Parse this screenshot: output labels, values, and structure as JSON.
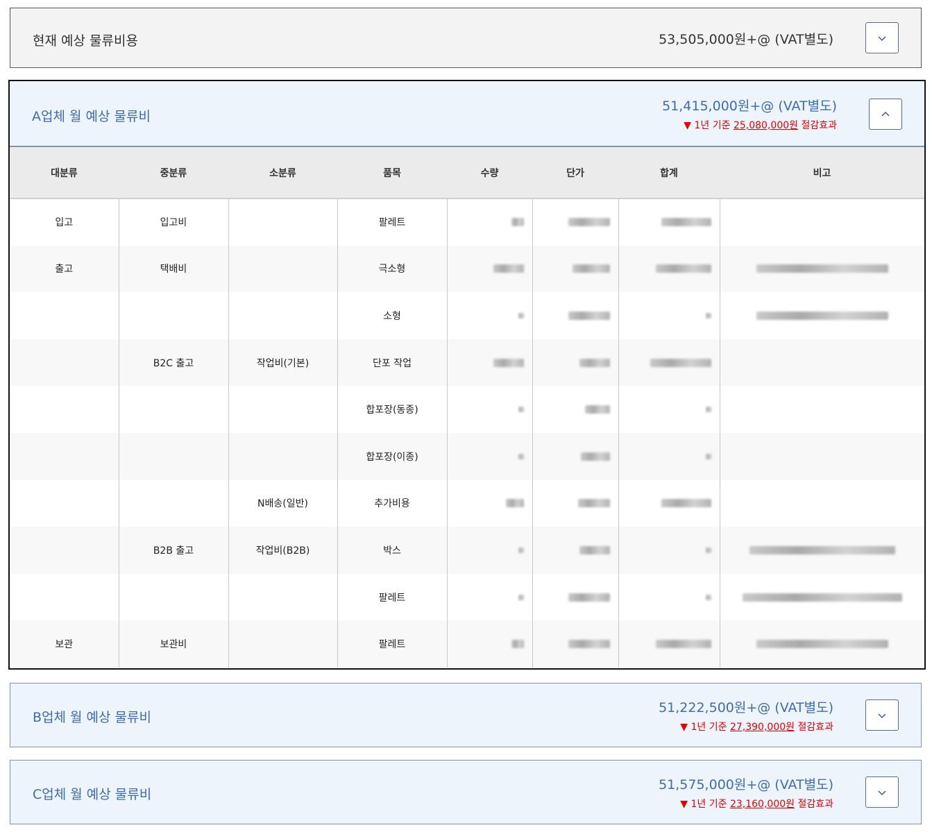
{
  "total": {
    "title": "현재 예상 물류비용",
    "amount": "53,505,000원+@ (VAT별도)",
    "toggle_icon": "chevron-down-icon"
  },
  "vendors": [
    {
      "title": "A업체 월 예상 물류비",
      "amount": "51,415,000원+@ (VAT별도)",
      "saving_prefix": "1년 기준 ",
      "saving_amount": "25,080,000원",
      "saving_suffix": " 절감효과",
      "expanded": true,
      "toggle_icon": "chevron-up-icon"
    },
    {
      "title": "B업체 월 예상 물류비",
      "amount": "51,222,500원+@ (VAT별도)",
      "saving_prefix": "1년 기준 ",
      "saving_amount": "27,390,000원",
      "saving_suffix": " 절감효과",
      "expanded": false,
      "toggle_icon": "chevron-down-icon"
    },
    {
      "title": "C업체 월 예상 물류비",
      "amount": "51,575,000원+@ (VAT별도)",
      "saving_prefix": "1년 기준 ",
      "saving_amount": "23,160,000원",
      "saving_suffix": " 절감효과",
      "expanded": false,
      "toggle_icon": "chevron-down-icon"
    }
  ],
  "table": {
    "headers": [
      "대분류",
      "중분류",
      "소분류",
      "품목",
      "수량",
      "단가",
      "합계",
      "비고"
    ],
    "rows": [
      [
        "입고",
        "입고비",
        "",
        "팔레트"
      ],
      [
        "출고",
        "택배비",
        "",
        "극소형"
      ],
      [
        "",
        "",
        "",
        "소형"
      ],
      [
        "",
        "B2C 출고",
        "작업비(기본)",
        "단포 작업"
      ],
      [
        "",
        "",
        "",
        "합포장(동종)"
      ],
      [
        "",
        "",
        "",
        "합포장(이종)"
      ],
      [
        "",
        "",
        "N배송(일반)",
        "추가비용"
      ],
      [
        "",
        "B2B 출고",
        "작업비(B2B)",
        "박스"
      ],
      [
        "",
        "",
        "",
        "팔레트"
      ],
      [
        "보관",
        "보관비",
        "",
        "팔레트"
      ]
    ]
  },
  "colors": {
    "accent_blue": "#3f6bb0",
    "saving_red": "#e60000",
    "panel_bg": "#eef4fc"
  }
}
